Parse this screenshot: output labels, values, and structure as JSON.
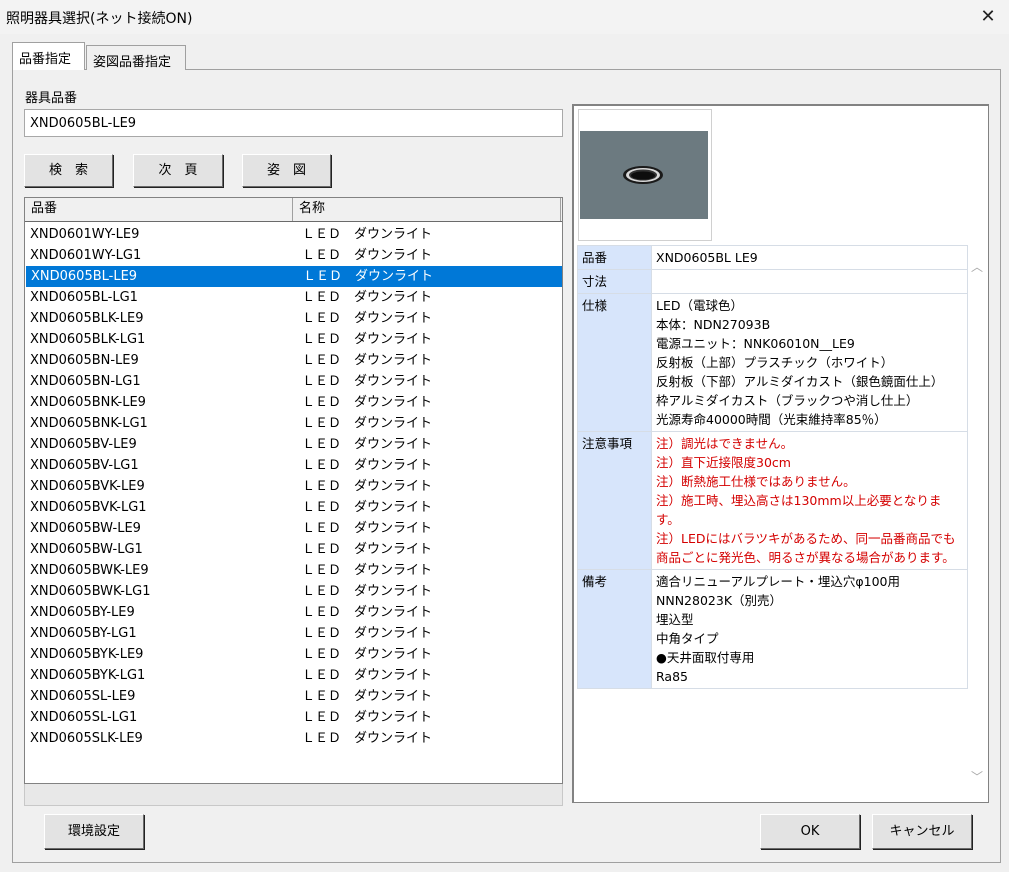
{
  "window": {
    "title": "照明器具選択(ネット接続ON)",
    "close_glyph": "✕"
  },
  "tabs": [
    {
      "label": "品番指定",
      "active": true
    },
    {
      "label": "姿図品番指定",
      "active": false
    }
  ],
  "search": {
    "label": "器具品番",
    "value": "XND0605BL-LE9"
  },
  "buttons": {
    "search": "検　索",
    "next_page": "次　頁",
    "figure": "姿　図",
    "env_settings": "環境設定",
    "ok": "OK",
    "cancel": "キャンセル"
  },
  "list": {
    "columns": [
      "品番",
      "名称"
    ],
    "selected_index": 2,
    "rows": [
      {
        "part": "XND0601WY-LE9",
        "name": "ＬＥＤ　ダウンライト"
      },
      {
        "part": "XND0601WY-LG1",
        "name": "ＬＥＤ　ダウンライト"
      },
      {
        "part": "XND0605BL-LE9",
        "name": "ＬＥＤ　ダウンライト"
      },
      {
        "part": "XND0605BL-LG1",
        "name": "ＬＥＤ　ダウンライト"
      },
      {
        "part": "XND0605BLK-LE9",
        "name": "ＬＥＤ　ダウンライト"
      },
      {
        "part": "XND0605BLK-LG1",
        "name": "ＬＥＤ　ダウンライト"
      },
      {
        "part": "XND0605BN-LE9",
        "name": "ＬＥＤ　ダウンライト"
      },
      {
        "part": "XND0605BN-LG1",
        "name": "ＬＥＤ　ダウンライト"
      },
      {
        "part": "XND0605BNK-LE9",
        "name": "ＬＥＤ　ダウンライト"
      },
      {
        "part": "XND0605BNK-LG1",
        "name": "ＬＥＤ　ダウンライト"
      },
      {
        "part": "XND0605BV-LE9",
        "name": "ＬＥＤ　ダウンライト"
      },
      {
        "part": "XND0605BV-LG1",
        "name": "ＬＥＤ　ダウンライト"
      },
      {
        "part": "XND0605BVK-LE9",
        "name": "ＬＥＤ　ダウンライト"
      },
      {
        "part": "XND0605BVK-LG1",
        "name": "ＬＥＤ　ダウンライト"
      },
      {
        "part": "XND0605BW-LE9",
        "name": "ＬＥＤ　ダウンライト"
      },
      {
        "part": "XND0605BW-LG1",
        "name": "ＬＥＤ　ダウンライト"
      },
      {
        "part": "XND0605BWK-LE9",
        "name": "ＬＥＤ　ダウンライト"
      },
      {
        "part": "XND0605BWK-LG1",
        "name": "ＬＥＤ　ダウンライト"
      },
      {
        "part": "XND0605BY-LE9",
        "name": "ＬＥＤ　ダウンライト"
      },
      {
        "part": "XND0605BY-LG1",
        "name": "ＬＥＤ　ダウンライト"
      },
      {
        "part": "XND0605BYK-LE9",
        "name": "ＬＥＤ　ダウンライト"
      },
      {
        "part": "XND0605BYK-LG1",
        "name": "ＬＥＤ　ダウンライト"
      },
      {
        "part": "XND0605SL-LE9",
        "name": "ＬＥＤ　ダウンライト"
      },
      {
        "part": "XND0605SL-LG1",
        "name": "ＬＥＤ　ダウンライト"
      },
      {
        "part": "XND0605SLK-LE9",
        "name": "ＬＥＤ　ダウンライト"
      }
    ]
  },
  "detail": {
    "part_label": "品番",
    "part_value": "XND0605BL LE9",
    "dims_label": "寸法",
    "dims_value": "",
    "spec_label": "仕様",
    "spec_lines": [
      "LED（電球色）",
      "本体：NDN27093B",
      "電源ユニット：NNK06010N__LE9",
      "反射板（上部）プラスチック（ホワイト）",
      "反射板（下部）アルミダイカスト（銀色鏡面仕上）",
      "枠アルミダイカスト（ブラックつや消し仕上）",
      "光源寿命40000時間（光束維持率85％）"
    ],
    "notes_label": "注意事項",
    "notes_lines": [
      "注）調光はできません。",
      "注）直下近接限度30cm",
      "注）断熱施工仕様ではありません。",
      "注）施工時、埋込高さは130mm以上必要となります。",
      "注）LEDにはバラツキがあるため、同一品番商品でも商品ごとに発光色、明るさが異なる場合があります。"
    ],
    "remarks_label": "備考",
    "remarks_lines": [
      "適合リニューアルプレート・埋込穴φ100用",
      "NNN28023K（別売）",
      "埋込型",
      "中角タイプ",
      "●天井面取付専用",
      "Ra85"
    ]
  },
  "colors": {
    "selection": "#0078d7",
    "key_cell": "#d7e5fb",
    "notes_text": "#d40000",
    "thumbnail_bg": "#6c7a80"
  }
}
